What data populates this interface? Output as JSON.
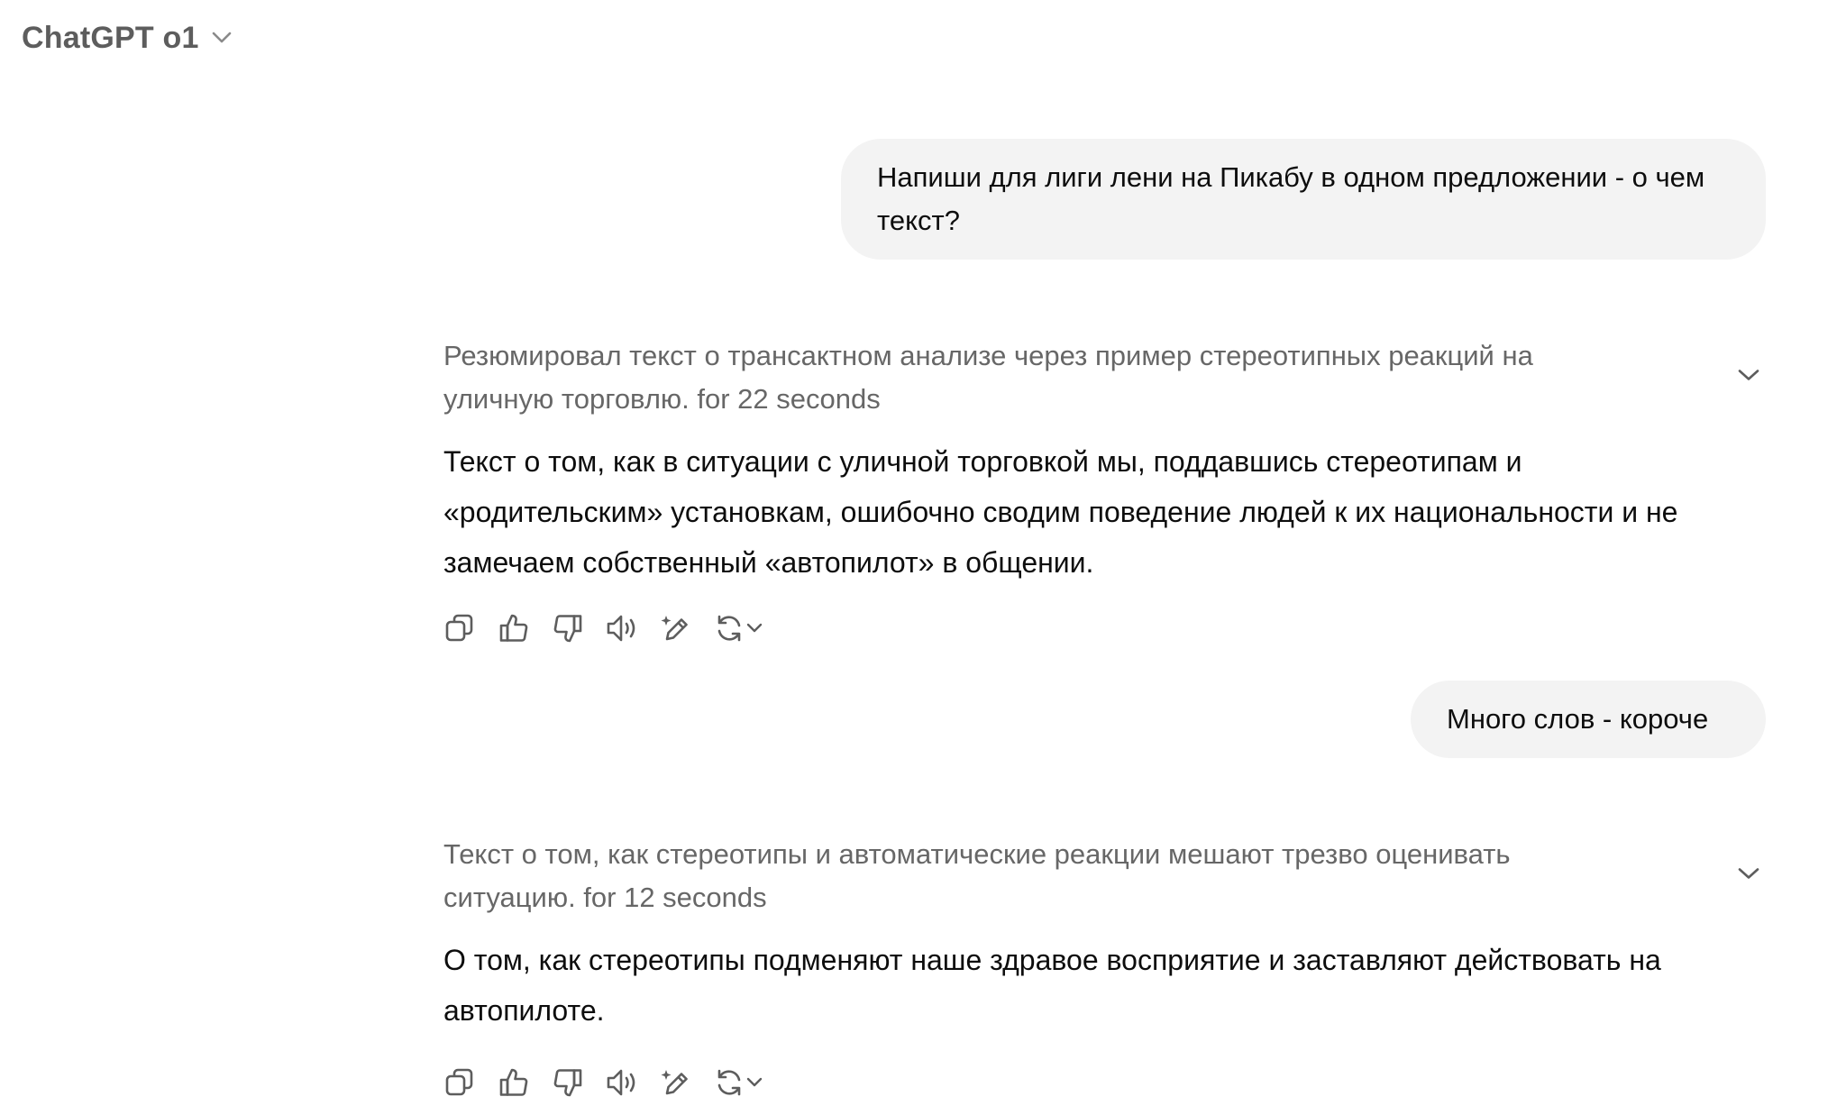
{
  "header": {
    "model_name": "ChatGPT o1",
    "model_chevron_icon": "chevron-down-icon"
  },
  "conversation": [
    {
      "role": "user",
      "text": "Напиши для лиги лени на Пикабу в одном предложении - о чем текст?"
    },
    {
      "role": "assistant",
      "thought_summary": "Резюмировал текст о трансактном анализе через пример стереотипных реакций на уличную торговлю. for 22 seconds",
      "answer": "Текст о том, как в ситуации с уличной торговкой мы, поддавшись стереотипам и «родительским» установкам, ошибочно сводим поведение людей к их национальности и не замечаем собственный «автопилот» в общении.",
      "actions": [
        "copy-icon",
        "thumbs-up-icon",
        "thumbs-down-icon",
        "read-aloud-icon",
        "edit-sparkle-icon",
        "regenerate-icon"
      ]
    },
    {
      "role": "user",
      "text": "Много слов - короче"
    },
    {
      "role": "assistant",
      "thought_summary": "Текст о том, как стереотипы и автоматические реакции мешают трезво оценивать ситуацию. for 12 seconds",
      "answer": "О том, как стереотипы подменяют наше здравое восприятие и заставляют действовать на автопилоте.",
      "actions": [
        "copy-icon",
        "thumbs-up-icon",
        "thumbs-down-icon",
        "read-aloud-icon",
        "edit-sparkle-icon",
        "regenerate-icon"
      ]
    }
  ],
  "colors": {
    "user_bubble_bg": "#f3f3f3",
    "text_primary": "#0d0d0d",
    "text_secondary": "#676767",
    "icon": "#5d5d5d"
  }
}
